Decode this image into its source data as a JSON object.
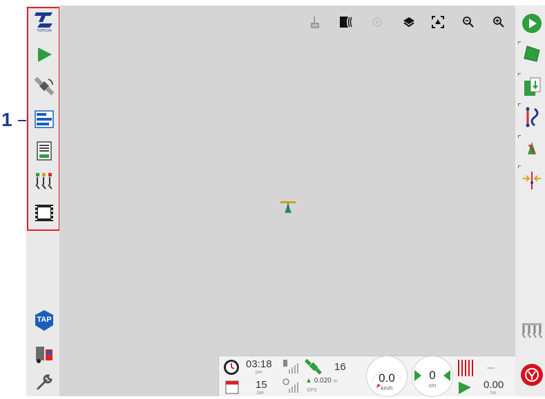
{
  "callout": {
    "number": "1"
  },
  "left_toolbar": {
    "items": [
      {
        "name": "topcon-logo",
        "label": "TOPCON"
      },
      {
        "name": "guidance"
      },
      {
        "name": "gps-satellite"
      },
      {
        "name": "job-list"
      },
      {
        "name": "field-info"
      },
      {
        "name": "implement-sections"
      },
      {
        "name": "screen-display"
      }
    ],
    "bottom": {
      "tap_label": "TAP"
    }
  },
  "top_toolbar": {
    "icons": [
      "touch-pan-icon",
      "swath-icon",
      "target-icon",
      "layers-icon",
      "fit-view-icon",
      "zoom-out-icon",
      "zoom-in-icon"
    ]
  },
  "status": {
    "time": "03:18",
    "time_period": "pm",
    "date_day": "15",
    "date_month": "Jan",
    "satellites": "16",
    "accuracy": "0.020",
    "accuracy_unit": "m",
    "source": "GPS",
    "speed": "0.0",
    "speed_unit": "km/h",
    "offset": "0",
    "offset_unit": "cm",
    "area_top": "---",
    "area": "0.00",
    "area_unit": "ha"
  },
  "colors": {
    "brand_blue": "#1b3a8f",
    "highlight_red": "#e0202a",
    "accent_green": "#2e9e3e",
    "map_grey": "#d5d5d5"
  }
}
